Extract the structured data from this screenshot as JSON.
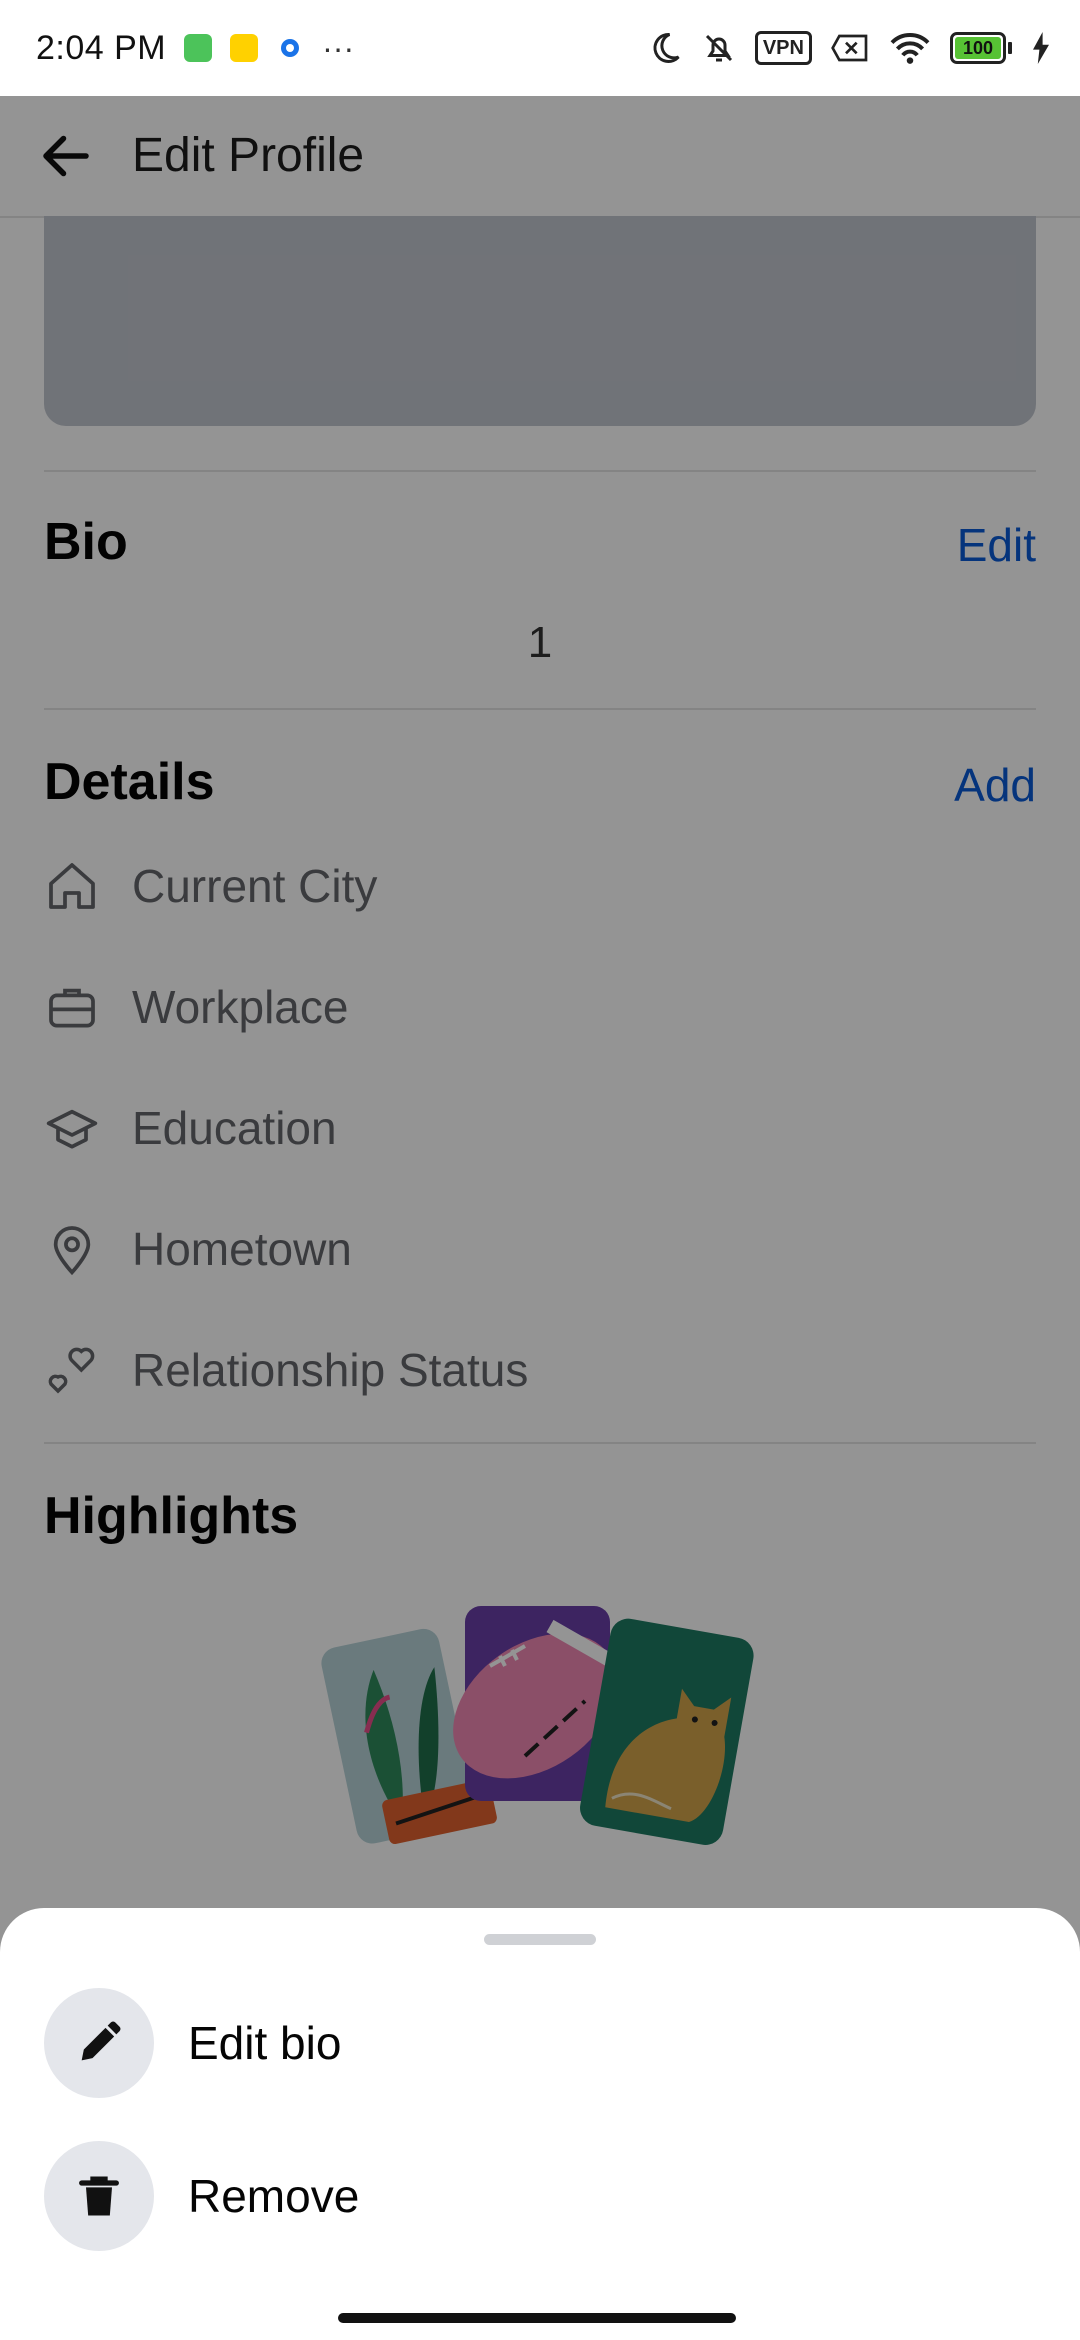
{
  "status_bar": {
    "time": "2:04 PM",
    "more": "···",
    "vpn": "VPN",
    "battery": "100"
  },
  "app_bar": {
    "title": "Edit Profile"
  },
  "bio": {
    "title": "Bio",
    "action": "Edit",
    "text": "1"
  },
  "details": {
    "title": "Details",
    "action": "Add",
    "items": [
      {
        "label": "Current City",
        "icon": "home-icon"
      },
      {
        "label": "Workplace",
        "icon": "briefcase-icon"
      },
      {
        "label": "Education",
        "icon": "graduation-cap-icon"
      },
      {
        "label": "Hometown",
        "icon": "location-pin-icon"
      },
      {
        "label": "Relationship Status",
        "icon": "hearts-icon"
      }
    ]
  },
  "highlights": {
    "title": "Highlights"
  },
  "sheet": {
    "items": [
      {
        "label": "Edit bio",
        "icon": "pencil-icon"
      },
      {
        "label": "Remove",
        "icon": "trash-icon"
      }
    ]
  },
  "colors": {
    "accent": "#0a5bd6",
    "overlay": "rgba(0,0,0,0.42)"
  }
}
